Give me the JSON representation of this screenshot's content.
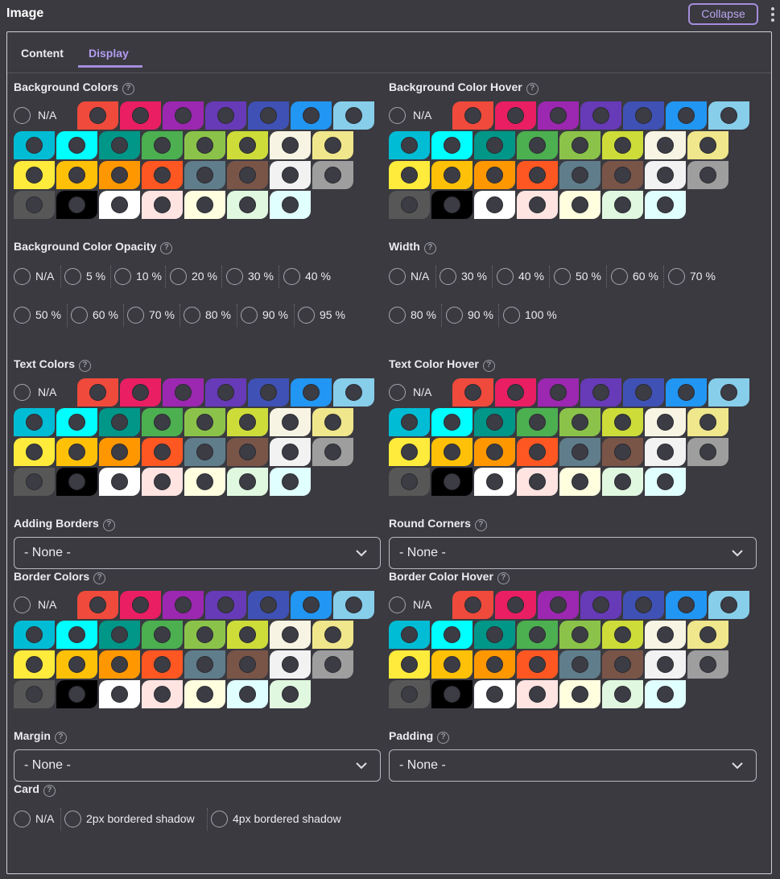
{
  "header": {
    "title": "Image",
    "collapse_label": "Collapse"
  },
  "tabs": [
    {
      "label": "Content"
    },
    {
      "label": "Display"
    }
  ],
  "na_label": "N/A",
  "swatch_colors": [
    [
      "#ef4a3c",
      "#e91e63",
      "#9c27b0",
      "#673ab7",
      "#3f51b5",
      "#2196f3",
      "#87ceeb"
    ],
    [
      "#00bcd4",
      "#00ffff",
      "#009688",
      "#4caf50",
      "#8bc34a",
      "#cddc39",
      "#f8f4e3",
      "#f0e68c"
    ],
    [
      "#ffeb3b",
      "#ffc107",
      "#ff9800",
      "#ff5722",
      "#607d8b",
      "#795548",
      "#f2f2f2",
      "#9e9e9e"
    ],
    [
      "#575757",
      "#000000",
      "#ffffff",
      "#ffe4e1",
      "#ffffe0",
      "#e0f8e0",
      "#e0ffff"
    ]
  ],
  "swatch_colors_border": [
    [
      "#ef4a3c",
      "#e91e63",
      "#9c27b0",
      "#673ab7",
      "#3f51b5",
      "#2196f3",
      "#87ceeb"
    ],
    [
      "#00bcd4",
      "#00ffff",
      "#009688",
      "#4caf50",
      "#8bc34a",
      "#cddc39",
      "#f8f4e3",
      "#f0e68c"
    ],
    [
      "#ffeb3b",
      "#ffc107",
      "#ff9800",
      "#ff5722",
      "#607d8b",
      "#795548",
      "#f2f2f2",
      "#9e9e9e"
    ],
    [
      "#575757",
      "#000000",
      "#ffffff",
      "#ffe4e1",
      "#ffffe0",
      "#e0ffff",
      "#e0f8e0"
    ]
  ],
  "labels": {
    "bg_colors": "Background Colors",
    "bg_color_hover": "Background Color Hover",
    "bg_opacity": "Background Color Opacity",
    "width": "Width",
    "text_colors": "Text Colors",
    "text_color_hover": "Text Color Hover",
    "adding_borders": "Adding Borders",
    "round_corners": "Round Corners",
    "border_colors": "Border Colors",
    "border_color_hover": "Border Color Hover",
    "margin": "Margin",
    "padding": "Padding",
    "card": "Card"
  },
  "help_glyph": "?",
  "opacity_options": [
    "N/A",
    "5 %",
    "10 %",
    "20 %",
    "30 %",
    "40 %",
    "50 %",
    "60 %",
    "70 %",
    "80 %",
    "90 %",
    "95 %"
  ],
  "width_options": [
    "N/A",
    "30 %",
    "40 %",
    "50 %",
    "60 %",
    "70 %",
    "80 %",
    "90 %",
    "100 %"
  ],
  "selects": {
    "adding_borders": "- None -",
    "round_corners": "- None -",
    "margin": "- None -",
    "padding": "- None -"
  },
  "card_options": [
    "N/A",
    "2px bordered shadow",
    "4px bordered shadow"
  ]
}
